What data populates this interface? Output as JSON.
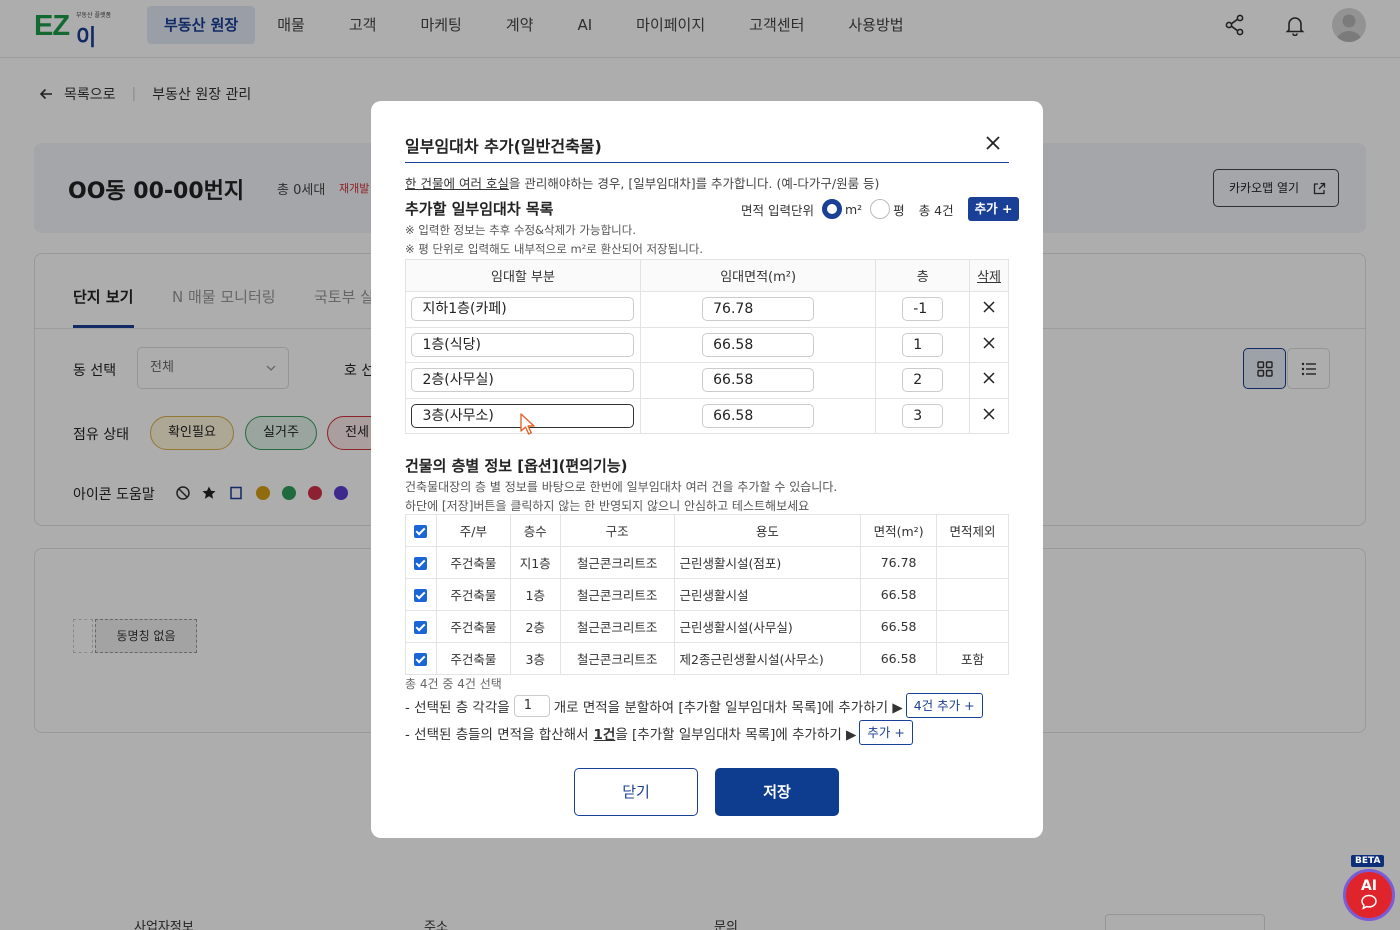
{
  "header": {
    "logo_main": "EZ",
    "logo_sub": "이지",
    "logo_tag": "부동산 플랫폼",
    "nav": [
      "부동산 원장",
      "매물",
      "고객",
      "마케팅",
      "계약",
      "AI",
      "마이페이지",
      "고객센터",
      "사용방법"
    ]
  },
  "background": {
    "back_label": "목록으로",
    "breadcrumb_title": "부동산 원장 관리",
    "property_title": "OO동 00-00번지",
    "household_count": "총 0세대",
    "redevelop_badge": "재개발",
    "kakao_btn": "카카오맵 열기",
    "tabs": [
      "단지 보기",
      "N 매물 모니터링",
      "국토부 실"
    ],
    "filter_dong_label": "동 선택",
    "filter_dong_value": "전체",
    "filter_ho_label": "호 선",
    "occupancy_label": "점유 상태",
    "occupancy_pills": [
      "확인필요",
      "실거주",
      "전세"
    ],
    "icon_help_label": "아이콘 도움말",
    "dong_empty": "동명칭 없음",
    "footer": [
      "사업자정보",
      "주소",
      "문의"
    ]
  },
  "modal": {
    "title": "일부임대차 추가(일반건축물)",
    "desc_underline": "한 건물에 여러 호실",
    "desc_rest": "을 관리해야하는 경우, [일부임대차]를 추가합니다. (예-다가구/원룸 등)",
    "list_title": "추가할 일부임대차 목록",
    "unit_label": "면적 입력단위",
    "unit_m2": "m²",
    "unit_py": "평",
    "total": "총 4건",
    "add_btn": "추가 +",
    "notes": [
      "※ 입력한 정보는 추후 수정&삭제가 가능합니다.",
      "※ 평 단위로 입력해도 내부적으로 m²로 환산되어 저장됩니다."
    ],
    "list_headers": [
      "임대할 부분",
      "임대면적(m²)",
      "층",
      "삭제"
    ],
    "list_rows": [
      {
        "part": "지하1층(카페)",
        "area": "76.78",
        "floor": "-1"
      },
      {
        "part": "1층(식당)",
        "area": "66.58",
        "floor": "1"
      },
      {
        "part": "2층(사무실)",
        "area": "66.58",
        "floor": "2"
      },
      {
        "part": "3층(사무소)",
        "area": "66.58",
        "floor": "3"
      }
    ],
    "floor_title": "건물의 층별 정보 [옵션](편의기능)",
    "floor_desc1": "건축물대장의 층 별 정보를 바탕으로 한번에 일부임대차 여러 건을 추가할 수 있습니다.",
    "floor_desc2": "하단에 [저장]버튼을 클릭하지 않는 한 반영되지 않으니 안심하고 테스트해보세요",
    "floor_headers": [
      "주/부",
      "층수",
      "구조",
      "용도",
      "면적(m²)",
      "면적제외"
    ],
    "floor_rows": [
      {
        "type": "주건축물",
        "floor": "지1층",
        "structure": "철근콘크리트조",
        "use": "근린생활시설(점포)",
        "area": "76.78",
        "exclude": ""
      },
      {
        "type": "주건축물",
        "floor": "1층",
        "structure": "철근콘크리트조",
        "use": "근린생활시설",
        "area": "66.58",
        "exclude": ""
      },
      {
        "type": "주건축물",
        "floor": "2층",
        "structure": "철근콘크리트조",
        "use": "근린생활시설(사무실)",
        "area": "66.58",
        "exclude": ""
      },
      {
        "type": "주건축물",
        "floor": "3층",
        "structure": "철근콘크리트조",
        "use": "제2종근린생활시설(사무소)",
        "area": "66.58",
        "exclude": "포함"
      }
    ],
    "summary": "총 4건 중 4건 선택",
    "action1_pre": "- 선택된 층 각각을",
    "action1_value": "1",
    "action1_post": "개로 면적을 분할하여 [추가할 일부임대차 목록]에 추가하기 ▶",
    "action1_btn": "4건 추가 +",
    "action2_pre": "- 선택된 층들의 면적을 합산해서",
    "action2_count": "1건",
    "action2_post": "을 [추가할 일부임대차 목록]에 추가하기 ▶",
    "action2_btn": "추가 +",
    "close_btn": "닫기",
    "save_btn": "저장"
  },
  "ai": {
    "label": "AI",
    "badge": "BETA"
  },
  "colors": {
    "primary": "#1a3f96",
    "logo_green": "#1e9b4a",
    "ai_red": "#e0242b"
  }
}
